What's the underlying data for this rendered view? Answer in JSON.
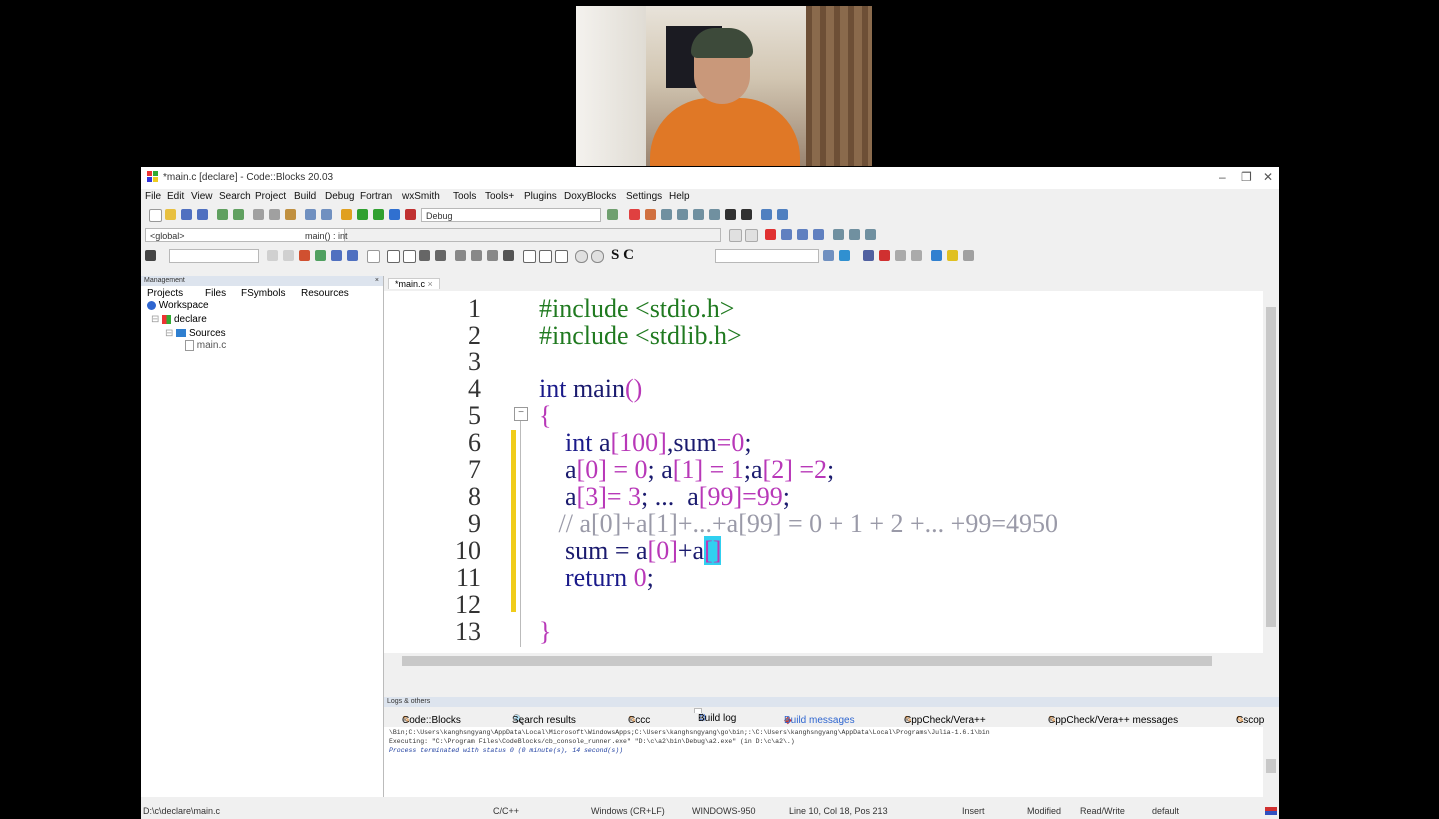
{
  "window": {
    "title": "*main.c [declare] - Code::Blocks 20.03",
    "controls": [
      "–",
      "❐",
      "✕"
    ]
  },
  "menu": [
    "File",
    "Edit",
    "View",
    "Search",
    "Project",
    "Build",
    "Debug",
    "Fortran",
    "wxSmith",
    "Tools",
    "Tools+",
    "Plugins",
    "DoxyBlocks",
    "Settings",
    "Help"
  ],
  "toolbar": {
    "build_target": "Debug",
    "scope": "<global>",
    "function": "main() : int",
    "sc_label": "S C"
  },
  "management": {
    "header": "Management",
    "tabs": [
      "Projects",
      "Files",
      "FSymbols",
      "Resources"
    ],
    "tree": {
      "workspace": "Workspace",
      "project": "declare",
      "folder": "Sources",
      "file": "main.c"
    }
  },
  "editor": {
    "tab_label": "*main.c",
    "line_numbers": [
      "1",
      "2",
      "3",
      "4",
      "5",
      "6",
      "7",
      "8",
      "9",
      "10",
      "11",
      "12",
      "13"
    ]
  },
  "logs": {
    "header": "Logs & others",
    "tabs": [
      "Code::Blocks",
      "Search results",
      "Cccc",
      "Build log",
      "Build messages",
      "CppCheck/Vera++",
      "CppCheck/Vera++ messages",
      "Cscop"
    ],
    "lines": [
      "\\Bin;C:\\Users\\kanghsngyang\\AppData\\Local\\Microsoft\\WindowsApps;C:\\Users\\kanghsngyang\\go\\bin;:\\C:\\Users\\kanghsngyang\\AppData\\Local\\Programs\\Julia-1.6.1\\bin",
      "Executing: \"C:\\Program Files\\CodeBlocks/cb_console_runner.exe\" \"D:\\c\\a2\\bin\\Debug\\a2.exe\"  (in D:\\c\\a2\\.)",
      "Process terminated with status 0 (0 minute(s), 14 second(s))"
    ]
  },
  "status": {
    "path": "D:\\c\\declare\\main.c",
    "language": "C/C++",
    "eol": "Windows (CR+LF)",
    "encoding": "WINDOWS-950",
    "position": "Line 10, Col 18, Pos 213",
    "mode": "Insert",
    "modified": "Modified",
    "access": "Read/Write",
    "profile": "default"
  }
}
